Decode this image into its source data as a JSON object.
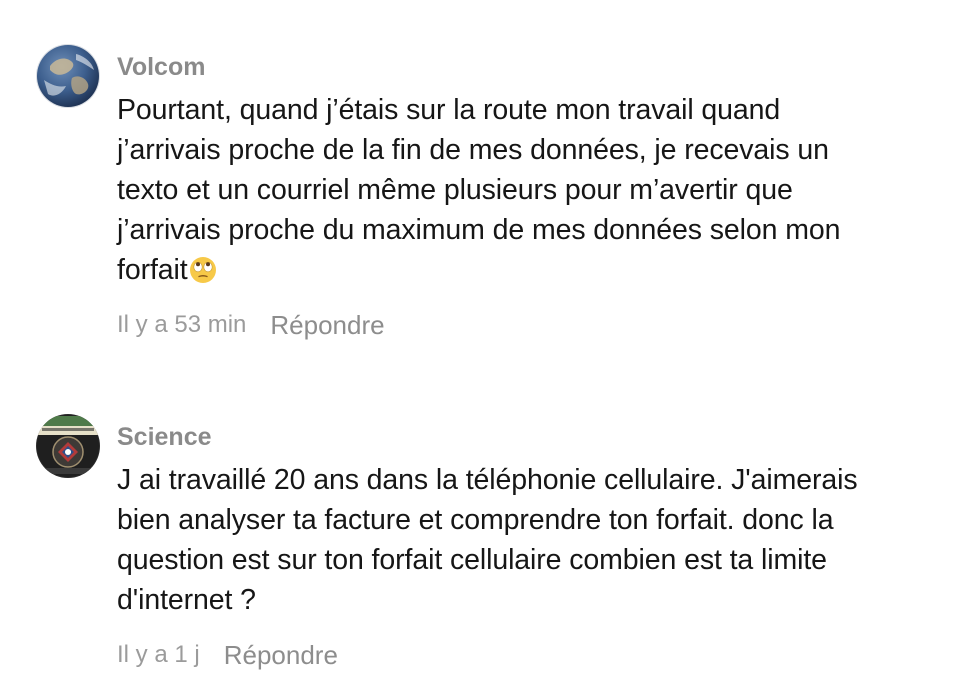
{
  "comments": [
    {
      "author": "Volcom",
      "avatar_icon": "earth-globe-avatar",
      "lines": [
        "Pourtant, quand j’étais sur la route mon travail quand",
        "j’arrivais proche de la fin de mes données, je recevais un",
        "texto et un courriel même plusieurs pour m’avertir que",
        "j’arrivais proche du maximum de mes données selon mon",
        "forfait"
      ],
      "emoji": "face-with-rolling-eyes",
      "time": "Il y a 53 min",
      "reply_label": "Répondre"
    },
    {
      "author": "Science",
      "avatar_icon": "emblem-badge-avatar",
      "lines": [
        "J ai travaillé 20 ans dans la téléphonie cellulaire. J'aimerais",
        "bien analyser ta facture et comprendre ton forfait. donc la",
        "question est sur ton forfait cellulaire combien est ta limite",
        "d'internet ?"
      ],
      "time": "Il y a 1 j",
      "reply_label": "Répondre"
    }
  ],
  "colors": {
    "author": "#8a8a8a",
    "text": "#161616",
    "meta": "#9b9b9b",
    "background": "#ffffff"
  }
}
